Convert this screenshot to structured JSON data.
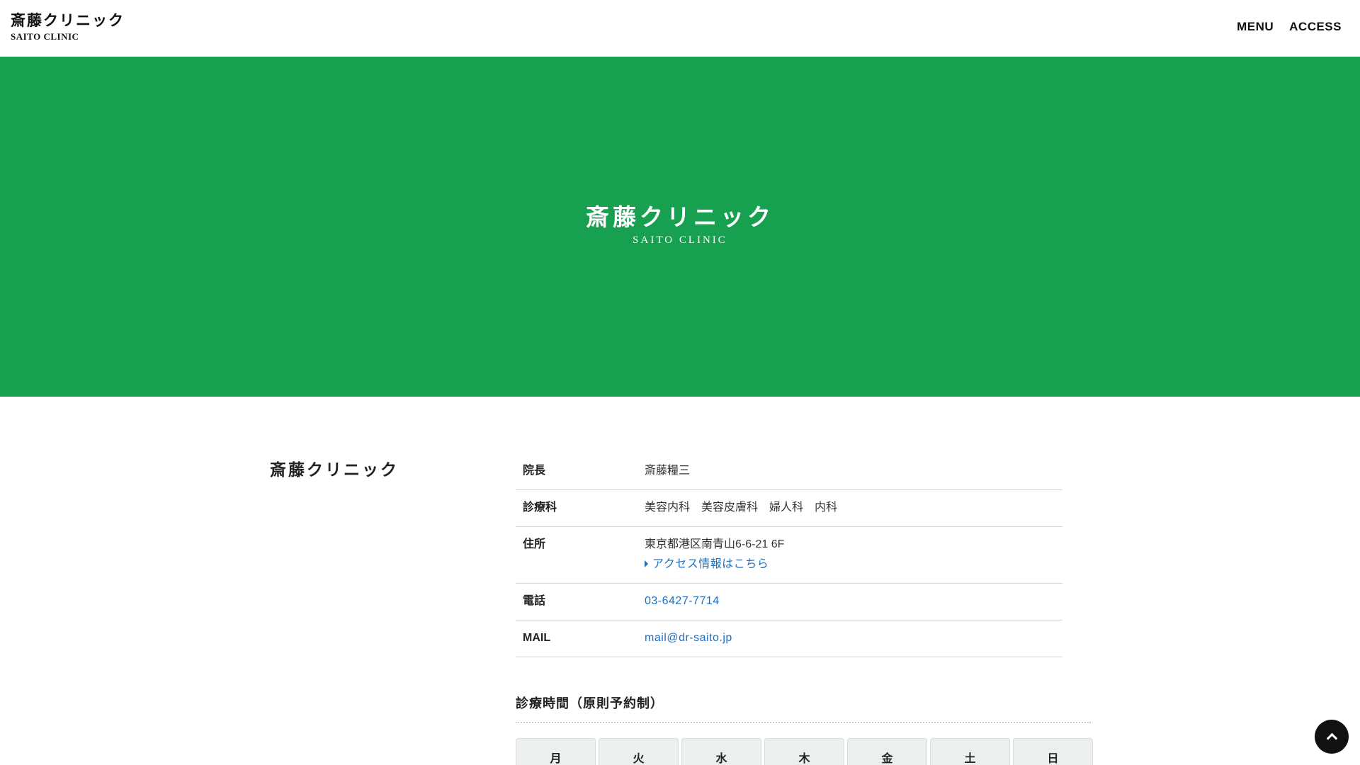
{
  "header": {
    "logo_jp": "斎藤クリニック",
    "logo_en": "SAITO CLINIC",
    "nav": [
      {
        "label": "MENU"
      },
      {
        "label": "ACCESS"
      }
    ]
  },
  "hero": {
    "title_jp": "斎藤クリニック",
    "title_en": "SAITO CLINIC",
    "background_color": "#16a050"
  },
  "info": {
    "clinic_name": "斎藤クリニック",
    "rows": [
      {
        "label": "院長",
        "value": "斎藤糧三"
      },
      {
        "label": "診療科",
        "value": "美容内科　美容皮膚科　婦人科　内科"
      },
      {
        "label": "住所",
        "value": "東京都港区南青山6-6-21 6F",
        "link": "アクセス情報はこちら"
      },
      {
        "label": "電話",
        "value": "03-6427-7714"
      },
      {
        "label": "MAIL",
        "value": "mail@dr-saito.jp"
      }
    ],
    "link_color": "#1f6fbf"
  },
  "hours": {
    "title": "診療時間（原則予約制）",
    "days": [
      "月",
      "火",
      "水",
      "木",
      "金",
      "土",
      "日"
    ]
  },
  "icons": {
    "back_to_top": "chevron-up-icon"
  }
}
